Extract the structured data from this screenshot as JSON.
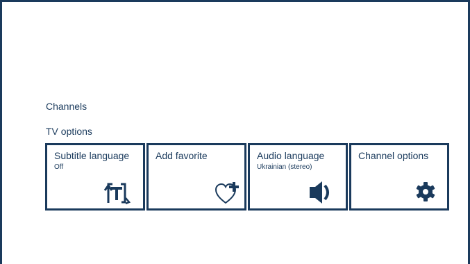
{
  "menu": {
    "section_channels": "Channels",
    "section_tv_options": "TV options"
  },
  "tiles": [
    {
      "title": "Subtitle language",
      "subtitle": "Off",
      "icon": "subtitle-icon"
    },
    {
      "title": "Add favorite",
      "subtitle": "",
      "icon": "heart-plus-icon"
    },
    {
      "title": "Audio language",
      "subtitle": "Ukrainian (stereo)",
      "icon": "speaker-icon"
    },
    {
      "title": "Channel options",
      "subtitle": "",
      "icon": "gear-icon"
    }
  ],
  "colors": {
    "accent": "#1a3a5c",
    "background": "#ffffff"
  }
}
